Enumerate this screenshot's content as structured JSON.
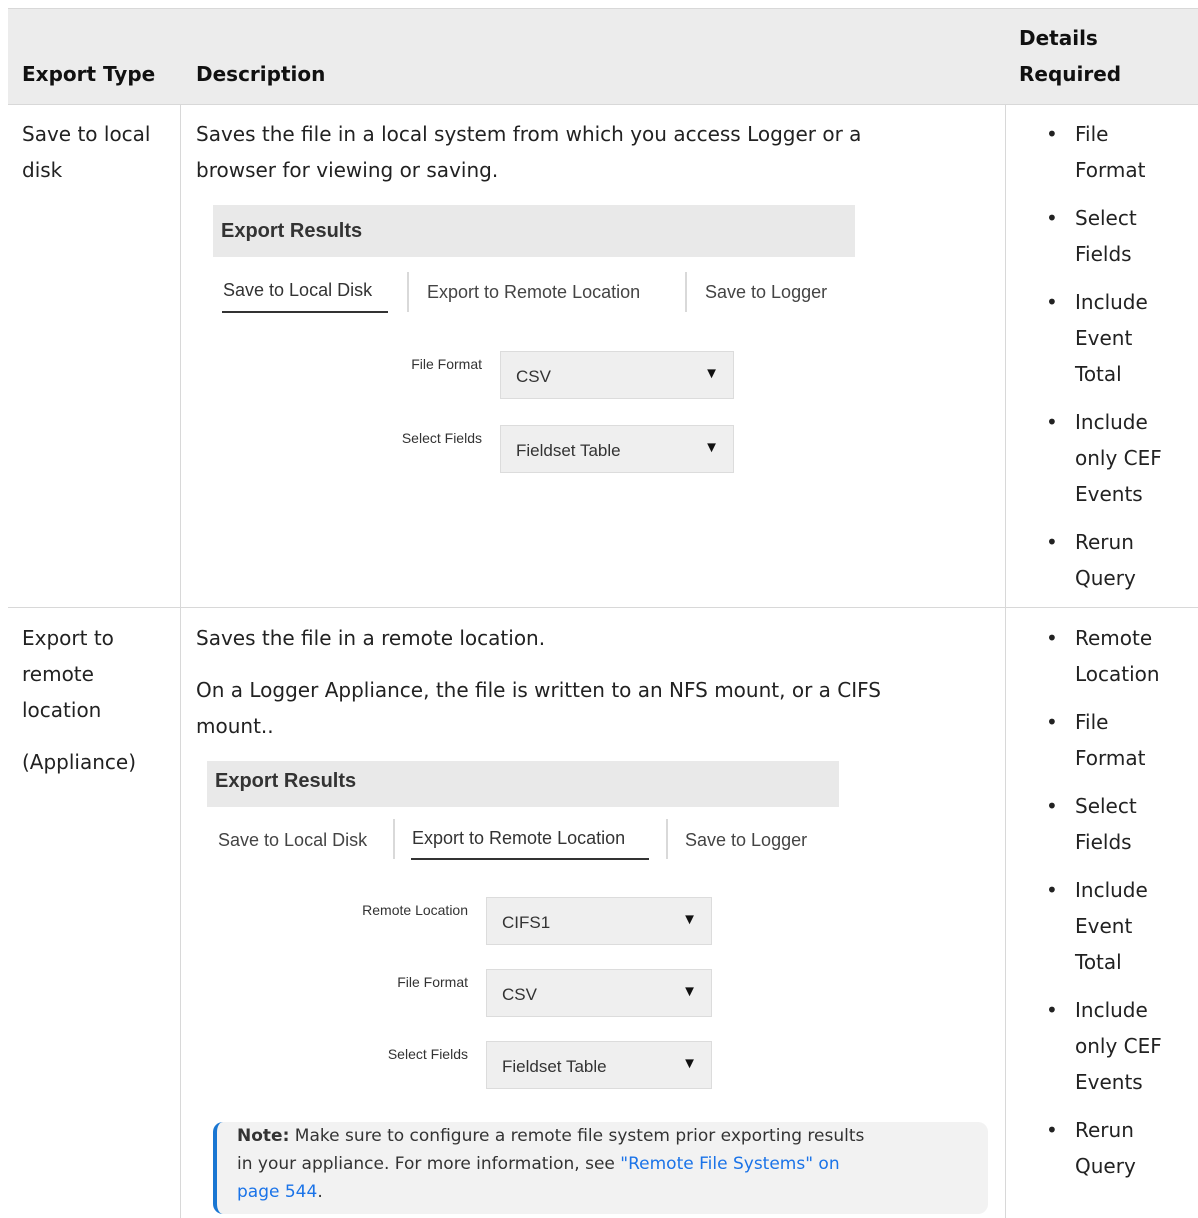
{
  "table": {
    "headers": {
      "export_type": "Export Type",
      "description": "Description",
      "details_line1": "Details",
      "details_line2": "Required"
    },
    "rows": [
      {
        "export_type": [
          "Save to local",
          "disk"
        ],
        "description": [
          "Saves the file in a local system from which you access Logger or a",
          "browser for viewing or saving."
        ],
        "dialog": {
          "title": "Export Results",
          "tabs": [
            "Save to Local Disk",
            "Export to Remote Location",
            "Save to Logger"
          ],
          "active_tab": "Save to Local Disk",
          "fields": [
            {
              "label": "File Format",
              "value": "CSV"
            },
            {
              "label": "Select Fields",
              "value": "Fieldset Table"
            }
          ]
        },
        "details": [
          [
            "File",
            "Format"
          ],
          [
            "Select",
            "Fields"
          ],
          [
            "Include",
            "Event",
            "Total"
          ],
          [
            "Include",
            "only CEF",
            "Events"
          ],
          [
            "Rerun",
            "Query"
          ]
        ]
      },
      {
        "export_type": [
          "Export to",
          "remote",
          "location"
        ],
        "export_type_note": "(Appliance)",
        "description_line1": "Saves the file in a remote location.",
        "description_para2": [
          "On a Logger Appliance, the file is written to an NFS mount, or a CIFS",
          "mount.."
        ],
        "dialog": {
          "title": "Export Results",
          "tabs": [
            "Save to Local Disk",
            "Export to Remote Location",
            "Save to Logger"
          ],
          "active_tab": "Export to Remote Location",
          "fields": [
            {
              "label": "Remote Location",
              "value": "CIFS1"
            },
            {
              "label": "File Format",
              "value": "CSV"
            },
            {
              "label": "Select Fields",
              "value": "Fieldset Table"
            }
          ]
        },
        "note": {
          "label": "Note:",
          "text_line1": " Make sure to configure a remote file system prior exporting results",
          "text_line2_a": "in your appliance. For more information, see ",
          "link_line2": "\"Remote File Systems\" on",
          "link_line3": "page 544",
          "text_line3_end": "."
        },
        "details": [
          [
            "Remote",
            "Location"
          ],
          [
            "File",
            "Format"
          ],
          [
            "Select",
            "Fields"
          ],
          [
            "Include",
            "Event",
            "Total"
          ],
          [
            "Include",
            "only CEF",
            "Events"
          ],
          [
            "Rerun",
            "Query"
          ]
        ]
      }
    ]
  },
  "icons": {
    "dropdown_arrow": "▼"
  },
  "colors": {
    "header_bg": "#ececec",
    "link": "#1a73e8",
    "note_accent": "#1976d2"
  }
}
